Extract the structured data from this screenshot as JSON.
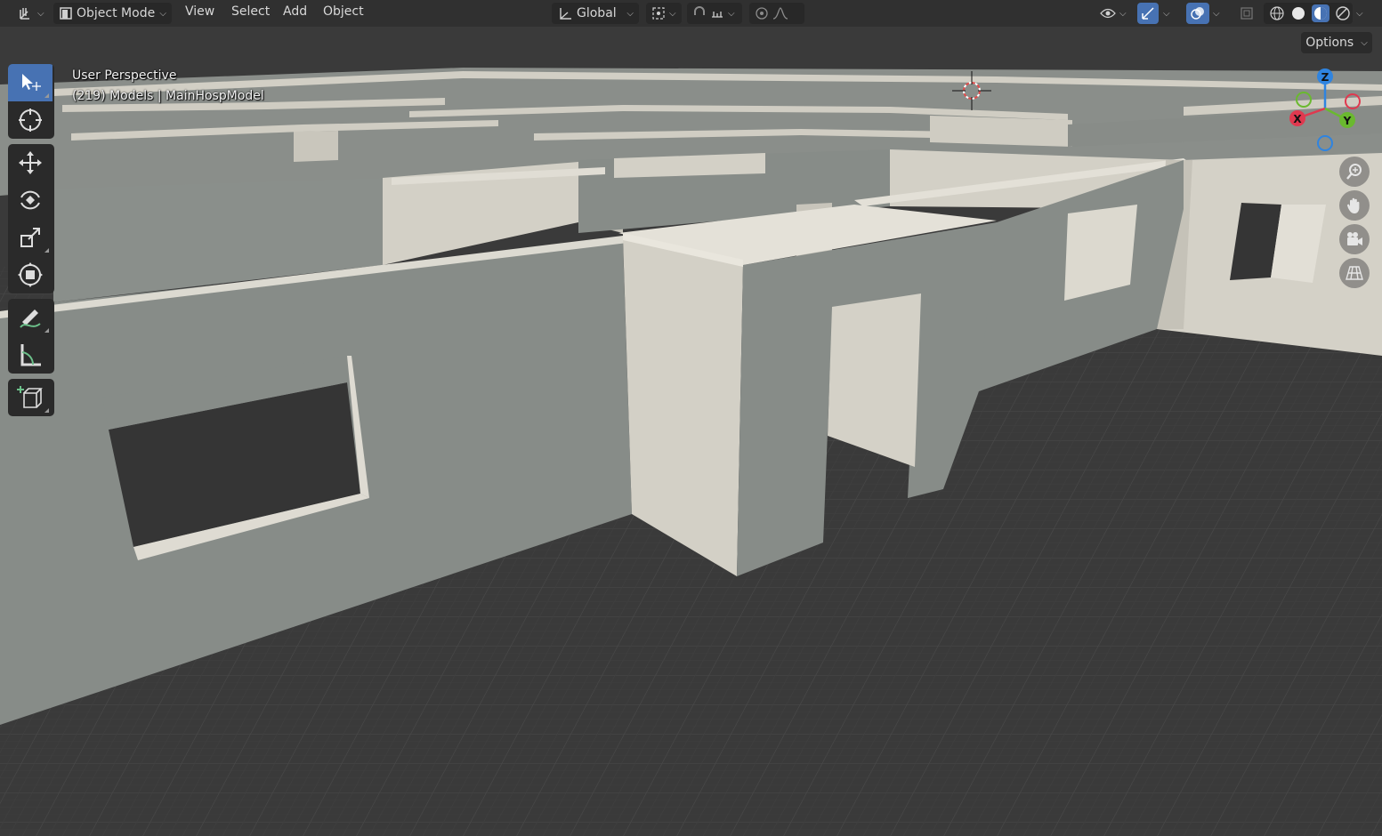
{
  "header": {
    "editor_type_icon": "axes-grid-icon",
    "mode_label": "Object Mode",
    "menus": [
      "View",
      "Select",
      "Add",
      "Object"
    ],
    "transform_orientation": "Global",
    "options_label": "Options"
  },
  "viewport": {
    "perspective_label": "User Perspective",
    "collection_label": "(219) Models | MainHospModel"
  },
  "toolbar": {
    "tools": [
      "select-box-icon",
      "cursor-icon",
      "move-icon",
      "rotate-icon",
      "scale-icon",
      "transform-icon",
      "annotate-icon",
      "measure-icon",
      "add-cube-icon"
    ],
    "active_tool": "select-box-icon"
  },
  "gizmo": {
    "x_label": "X",
    "y_label": "Y",
    "z_label": "Z",
    "colors": {
      "x": "#e0394f",
      "y": "#6ab92f",
      "z": "#2f84e0",
      "accent": "#4772b3"
    }
  },
  "scene": {
    "wall_light": "#d3d0c6",
    "wall_mid": "#878c88",
    "floor": "#3a3a3a"
  }
}
